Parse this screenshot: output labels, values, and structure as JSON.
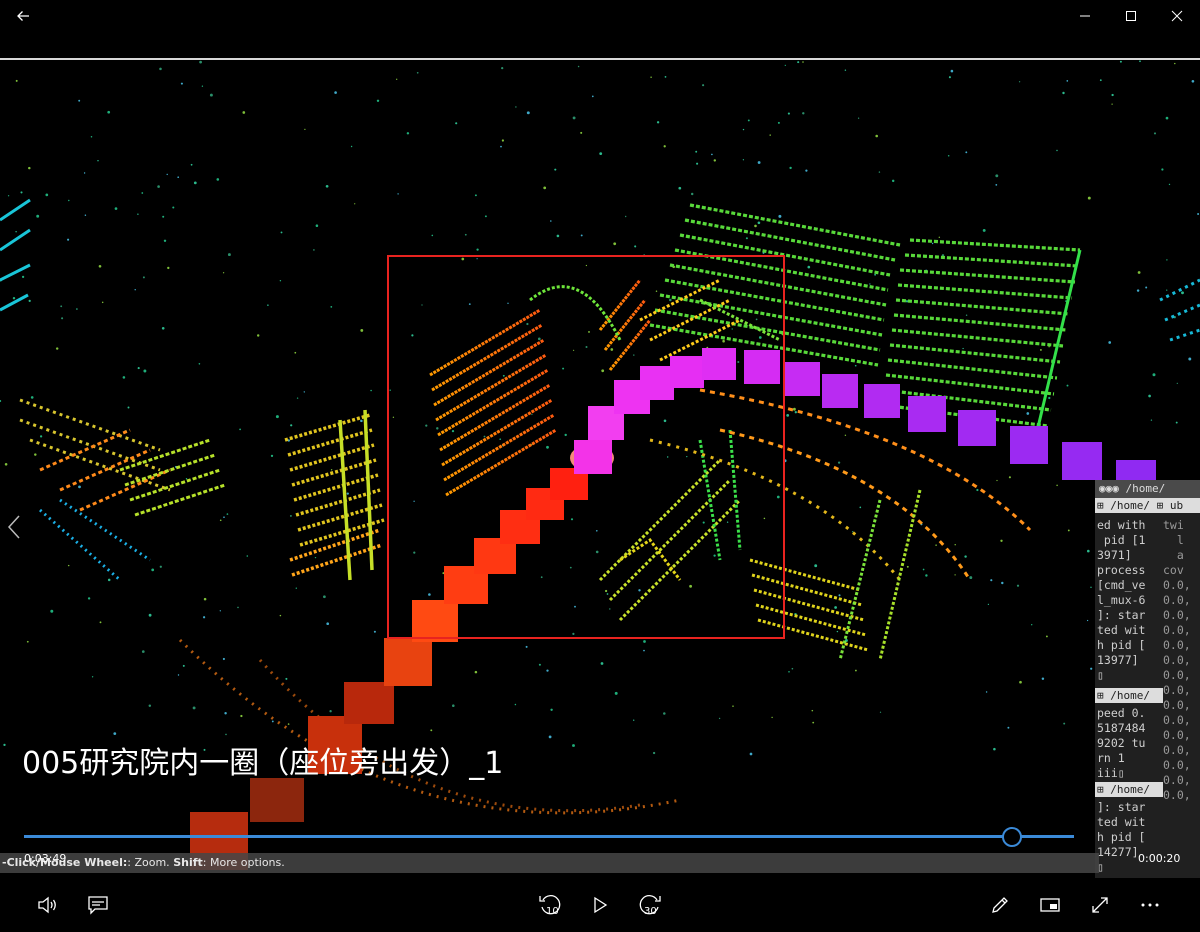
{
  "window": {
    "back_icon": "back-arrow-icon",
    "minimize_icon": "minimize-icon",
    "maximize_icon": "maximize-icon",
    "close_icon": "close-icon"
  },
  "video": {
    "caption": "005研究院内一圈（座位旁出发）_1",
    "status_hint_prefix": "-Click/Mouse Wheel:",
    "status_hint_zoom": ": Zoom. ",
    "status_hint_shift": "Shift",
    "status_hint_rest": ": More options.",
    "selection_box_color": "#e8231f"
  },
  "terminal": {
    "header": "/home/",
    "tab_left": "/home/",
    "tab_right": "ub",
    "lines_left": [
      "ed with",
      " pid [1",
      "3971]",
      "process",
      "[cmd_ve",
      "l_mux-6",
      "]: star",
      "ted wit",
      "h pid [",
      "13977]",
      "▯"
    ],
    "tab2": "/home/",
    "lines_left2": [
      "peed 0.",
      "5187484",
      "9202 tu",
      "rn 1",
      "iii▯"
    ],
    "tab3": "/home/",
    "lines_left3": [
      "]: star",
      "ted wit",
      "h pid [",
      "14277]",
      "▯"
    ],
    "lines_right": [
      "twi",
      "  l",
      "",
      "",
      "",
      "",
      "  a",
      "",
      "",
      "",
      "cov",
      "0.0,",
      "0.0,",
      "0.0,",
      "0.0,",
      "0.0,",
      "0.0,",
      "0.0,",
      "0.0,",
      "0.0,",
      "0.0,",
      "0.0,",
      "0.0,",
      "0.0,",
      "0.0,",
      "0.0,"
    ]
  },
  "player": {
    "elapsed": "0:03:49",
    "remaining": "0:00:20",
    "progress_fraction": 0.92,
    "skip_back_label": "10",
    "skip_forward_label": "30",
    "accent_color": "#3b8ad8"
  }
}
